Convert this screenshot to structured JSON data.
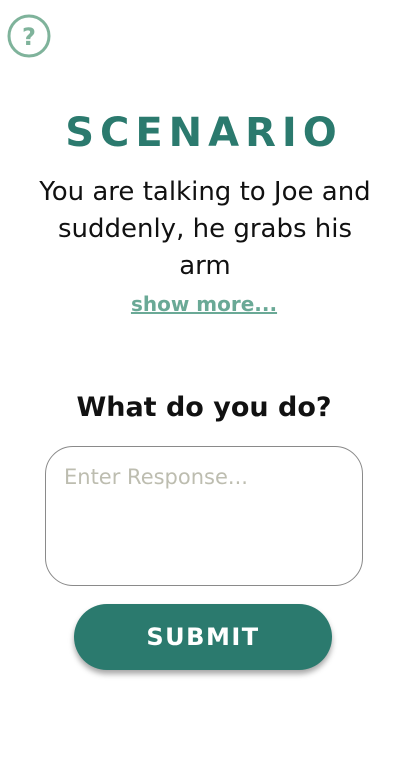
{
  "help": {
    "icon": "question-circle-icon",
    "glyph": "?"
  },
  "scenario": {
    "title": "SCENARIO",
    "text": "You are talking to Joe and suddenly, he grabs his arm",
    "show_more": "show more..."
  },
  "prompt": {
    "question": "What do you do?"
  },
  "response": {
    "placeholder": "Enter Response...",
    "value": ""
  },
  "submit": {
    "label": "SUBMIT"
  },
  "colors": {
    "accent": "#2b7a6e",
    "link": "#6aa996",
    "help_icon": "#7fb39b"
  }
}
